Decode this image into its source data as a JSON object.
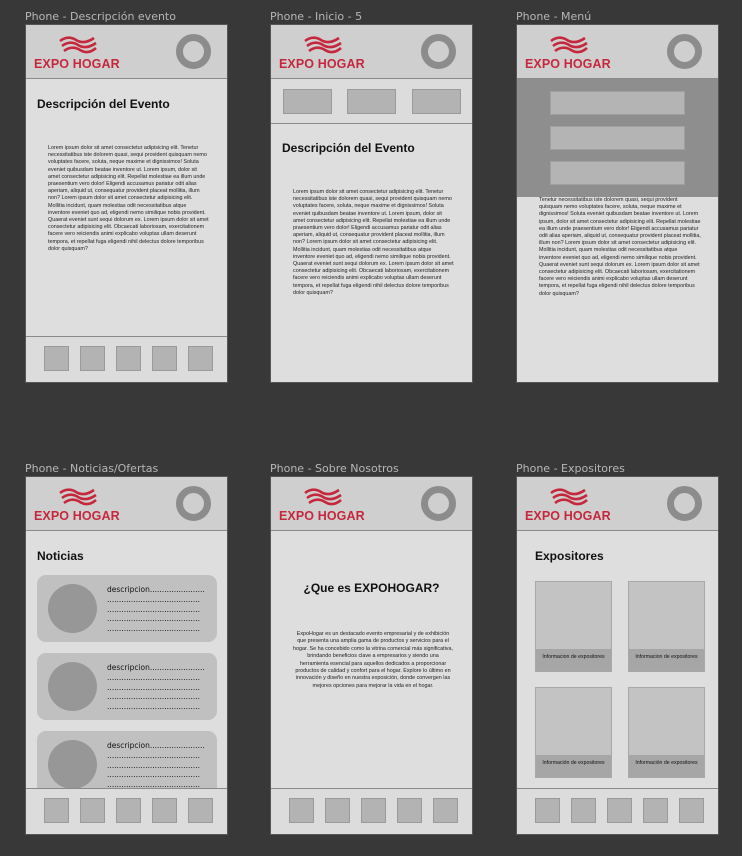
{
  "brand": {
    "name": "EXPO HOGAR",
    "color": "#c5283d"
  },
  "frames": [
    {
      "label": "Phone - Descripción evento",
      "title": "Descripción del Evento",
      "body": "Lorem ipsum dolor sit amet consectetur adipisicing elit. Tenetur necessitatibus iste dolorem quasi, sequi provident quisquam nemo voluptates facere, soluta, neque maxime et dignissimos! Soluta eveniet quibusdam beatae inventore ut. Lorem ipsum, dolor sit amet consectetur adipisicing elit. Repellat molestiae ea illum unde praesentium vero dolor! Eligendi accusamus pariatur odit alias aperiam, aliquid ut, consequatur provident placeat mollitia, illum non? Lorem ipsum dolor sit amet consectetur adipisicing elit. Mollitia incidunt, quam molestias odit necessitatibus atque inventore eveniet quo ad, eligendi nemo similique nobis provident. Quaerat eveniet sunt sequi dolorum ex. Lorem ipsum dolor sit amet consectetur adipisicing elit. Obcaecati laboriosam, exercitationem facere vero reiciendis animi explicabo voluptas ullam deserunt tempora, et repellat fuga eligendi nihil delectus dolore temporibus dolor quisquam?"
    },
    {
      "label": "Phone - Inicio - 5",
      "title": "Descripción del Evento",
      "body": "Lorem ipsum dolor sit amet consectetur adipisicing elit. Tenetur necessitatibus iste dolorem quasi, sequi provident quisquam nemo voluptates facere, soluta, neque maxime et dignissimos! Soluta eveniet quibusdam beatae inventore ut. Lorem ipsum, dolor sit amet consectetur adipisicing elit. Repellat molestiae ea illum unde praesentium vero dolor! Eligendi accusamus pariatur odit alias aperiam, aliquid ut, consequatur provident placeat mollitia, illum non? Lorem ipsum dolor sit amet consectetur adipisicing elit. Mollitia incidunt, quam molestias odit necessitatibus atque inventore eveniet quo ad, eligendi nemo similique nobis provident. Quaerat eveniet sunt sequi dolorum ex. Lorem ipsum dolor sit amet consectetur adipisicing elit. Obcaecati laboriosam, exercitationem facere vero reiciendis animi explicabo voluptas ullam deserunt tempora, et repellat fuga eligendi nihil delectus dolore temporibus dolor quisquam?"
    },
    {
      "label": "Phone - Menú",
      "body": "Tenetur necessitatibus iste dolorem quasi, sequi provident quisquam nemo voluptates facere, soluta, neque maxime et dignissimos! Soluta eveniet quibusdam beatae inventore ut. Lorem ipsum, dolor sit amet consectetur adipisicing elit. Repellat molestiae ea illum unde praesentium vero dolor! Eligendi accusamus pariatur odit alias aperiam, aliquid ut, consequatur provident placeat mollitia, illum non? Lorem ipsum dolor sit amet consectetur adipisicing elit. Mollitia incidunt, quam molestias odit necessitatibus atque inventore eveniet quo ad, eligendi nemo similique nobis provident. Quaerat eveniet sunt sequi dolorum ex. Lorem ipsum dolor sit amet consectetur adipisicing elit. Obcaecati laboriosam, exercitationem facere vero reiciendis animi explicabo voluptas ullam deserunt tempora, et repellat fuga eligendi nihil delectus dolore temporibus dolor quisquam?"
    },
    {
      "label": "Phone - Noticias/Ofertas",
      "title": "Noticias",
      "news_desc": "descripcion.......................\n.......................................\n.......................................\n.......................................\n......................................."
    },
    {
      "label": "Phone - Sobre Nosotros",
      "title": "¿Que es EXPOHOGAR?",
      "body": "ExpoHogar es un destacado evento empresarial y de exhibición que presenta una amplia gama de productos y servicios para el hogar. Se ha concebido como la vitrina comercial más significativa, brindando beneficios clave a empresarios y siendo una herramienta esencial para aquellos dedicados a proporcionar productos de calidad y confort para el hogar. Explore lo último en innovación y diseño en nuestra exposición, donde convergen las mejores opciones para mejorar la vida en el hogar."
    },
    {
      "label": "Phone - Expositores",
      "title": "Expositores",
      "cards": [
        "Informacion de expositores",
        "Informacion de expositores",
        "Información de expositores",
        "Información de expositores"
      ]
    }
  ]
}
